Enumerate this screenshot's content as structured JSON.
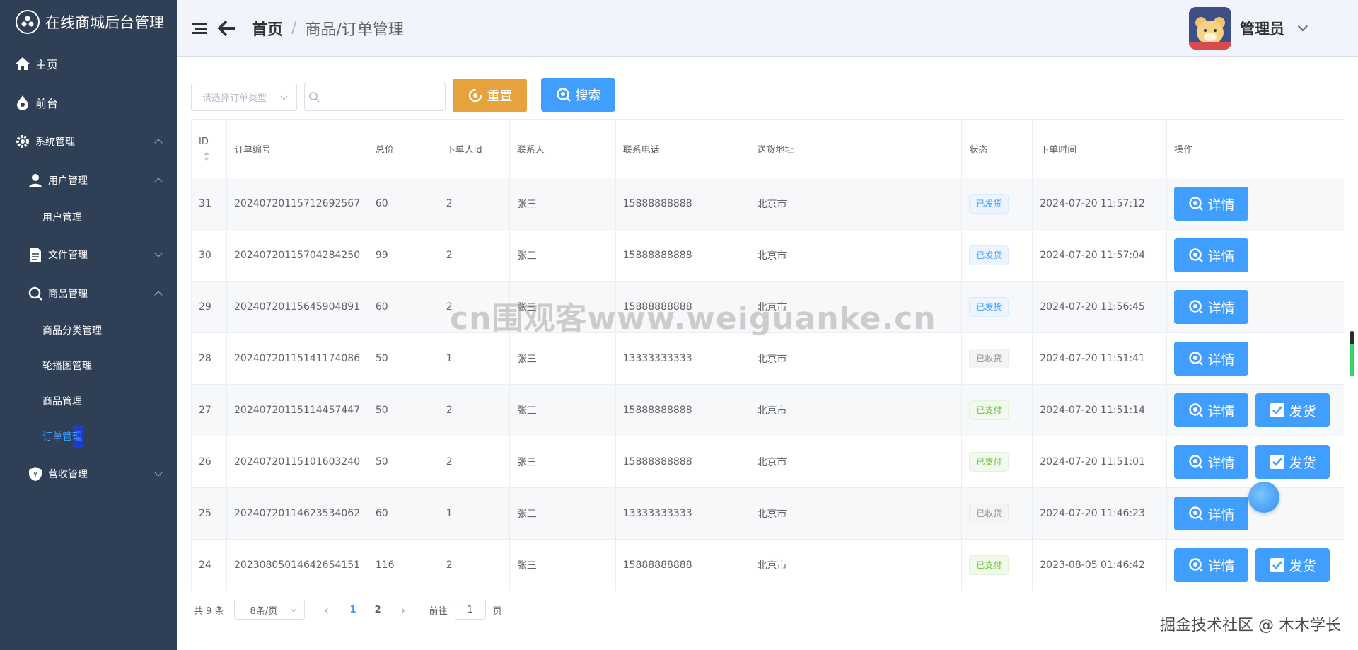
{
  "sidebar": {
    "brand": "在线商城后台管理",
    "items": [
      {
        "label": "主页"
      },
      {
        "label": "前台"
      },
      {
        "label": "系统管理"
      },
      {
        "label": "用户管理"
      },
      {
        "label": "用户管理"
      },
      {
        "label": "文件管理"
      },
      {
        "label": "商品管理"
      },
      {
        "label": "商品分类管理"
      },
      {
        "label": "轮播图管理"
      },
      {
        "label": "商品管理"
      },
      {
        "label": "订单管理"
      },
      {
        "label": "营收管理"
      }
    ]
  },
  "header": {
    "breadcrumb_home": "首页",
    "breadcrumb_sep": "/",
    "breadcrumb_current": "商品/订单管理",
    "user_name": "管理员"
  },
  "filters": {
    "type_placeholder": "请选择订单类型",
    "search_value": "",
    "reset_label": "重置",
    "search_label": "搜索"
  },
  "table": {
    "columns": [
      "ID",
      "订单编号",
      "总价",
      "下单人id",
      "联系人",
      "联系电话",
      "送货地址",
      "状态",
      "下单时间",
      "操作"
    ],
    "detail_label": "详情",
    "ship_label": "发货",
    "rows": [
      {
        "id": "31",
        "no": "20240720115712692567",
        "total": "60",
        "uid": "2",
        "contact": "张三",
        "phone": "15888888888",
        "addr": "北京市",
        "status": "已发货",
        "time": "2024-07-20 11:57:12"
      },
      {
        "id": "30",
        "no": "20240720115704284250",
        "total": "99",
        "uid": "2",
        "contact": "张三",
        "phone": "15888888888",
        "addr": "北京市",
        "status": "已发货",
        "time": "2024-07-20 11:57:04"
      },
      {
        "id": "29",
        "no": "20240720115645904891",
        "total": "60",
        "uid": "2",
        "contact": "张三",
        "phone": "15888888888",
        "addr": "北京市",
        "status": "已发货",
        "time": "2024-07-20 11:56:45"
      },
      {
        "id": "28",
        "no": "20240720115141174086",
        "total": "50",
        "uid": "1",
        "contact": "张三",
        "phone": "13333333333",
        "addr": "北京市",
        "status": "已收货",
        "time": "2024-07-20 11:51:41"
      },
      {
        "id": "27",
        "no": "20240720115114457447",
        "total": "50",
        "uid": "2",
        "contact": "张三",
        "phone": "15888888888",
        "addr": "北京市",
        "status": "已支付",
        "time": "2024-07-20 11:51:14"
      },
      {
        "id": "26",
        "no": "20240720115101603240",
        "total": "50",
        "uid": "2",
        "contact": "张三",
        "phone": "15888888888",
        "addr": "北京市",
        "status": "已支付",
        "time": "2024-07-20 11:51:01"
      },
      {
        "id": "25",
        "no": "20240720114623534062",
        "total": "60",
        "uid": "1",
        "contact": "张三",
        "phone": "13333333333",
        "addr": "北京市",
        "status": "已收货",
        "time": "2024-07-20 11:46:23"
      },
      {
        "id": "24",
        "no": "20230805014642654151",
        "total": "116",
        "uid": "2",
        "contact": "张三",
        "phone": "15888888888",
        "addr": "北京市",
        "status": "已支付",
        "time": "2023-08-05 01:46:42"
      }
    ]
  },
  "pagination": {
    "total_text": "共 9 条",
    "page_size": "8条/页",
    "prev": "‹",
    "next": "›",
    "pages": [
      "1",
      "2"
    ],
    "goto_label": "前往",
    "goto_value": "1",
    "page_suffix": "页"
  },
  "watermark": "cn围观客www.weiguanke.cn",
  "credit": "掘金技术社区 @ 木木学长",
  "colors": {
    "sidebar_bg": "#2f4056",
    "primary": "#409eff",
    "warning": "#e6a23c",
    "success": "#67c23a"
  }
}
